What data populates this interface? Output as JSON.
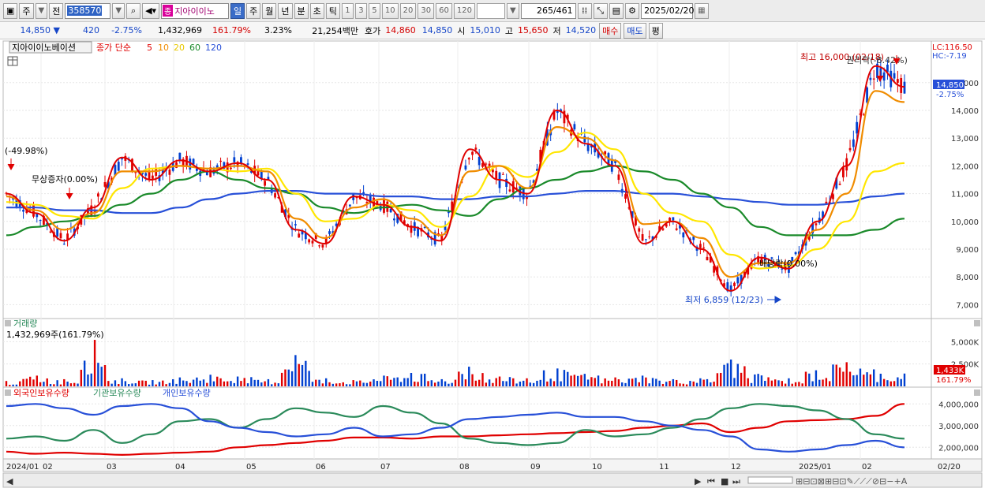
{
  "toolbar": {
    "period_label": "주",
    "prev_label": "전",
    "stock_code": "358570",
    "stock_tag": "종",
    "stock_name": "지아이이노",
    "tf_day": "일",
    "tf_week": "주",
    "tf_month": "월",
    "tf_year": "년",
    "tf_min": "분",
    "tf_sec": "초",
    "tf_tick": "틱",
    "intervals": [
      "1",
      "3",
      "5",
      "10",
      "20",
      "30",
      "60",
      "120"
    ],
    "count": "265",
    "count_total": "/461",
    "date": "2025/02/20"
  },
  "quote": {
    "price": "14,850",
    "change": "420",
    "change_pct": "-2.75%",
    "volume": "1,432,969",
    "volume_ratio": "161.79%",
    "turnover": "3.23%",
    "amount": "21,254백만",
    "bid_label": "호가",
    "bid1": "14,860",
    "bid2": "14,850",
    "open_label": "시",
    "open": "15,010",
    "high_label": "고",
    "high": "15,650",
    "low_label": "저",
    "low": "14,520",
    "buy_label": "매수",
    "sell_label": "매도",
    "eval_label": "평"
  },
  "legend": {
    "name": "지아이이노베이션",
    "ma_label": "종가 단순",
    "ma": [
      "5",
      "10",
      "20",
      "60",
      "120"
    ]
  },
  "colors": {
    "up": "#e00000",
    "down": "#0040d0",
    "ma5": "#e00000",
    "ma10": "#f08c00",
    "ma20": "#ffe600",
    "ma60": "#1a8a2a",
    "ma120": "#2850d8",
    "foreign": "#e00000",
    "institution": "#2a8a5a",
    "individual": "#2850d8"
  },
  "annotations": {
    "lc": "LC:116.50",
    "hc": "HC:-7.19",
    "max": "최고 16,000 (02/18)",
    "min": "최저 6,859 (12/23)",
    "right_issue": "권리락(-8.42%)",
    "drop1": "(-49.98%)",
    "bonus_issue": "무상증자(0.00%)",
    "dividend": "배당락(0.00%)",
    "price_tag": "14,850",
    "pct_tag": "-2.75%"
  },
  "volume_panel": {
    "title": "거래량",
    "value": "1,432,969주(161.79%)",
    "tag": "1,433K",
    "tag_pct": "161.79%"
  },
  "holding_panel": {
    "foreign": "외국인보유수량",
    "institution": "기관보유수량",
    "individual": "개인보유수량"
  },
  "chart_data": [
    {
      "type": "candlestick",
      "title": "지아이이노베이션",
      "x": [
        "2024/01",
        "02",
        "03",
        "04",
        "05",
        "06",
        "07",
        "08",
        "09",
        "10",
        "11",
        "12",
        "2025/01",
        "02",
        "02/20"
      ],
      "ylim": [
        6500,
        16500
      ],
      "yticks": [
        7000,
        8000,
        9000,
        10000,
        11000,
        12000,
        13000,
        14000,
        15000
      ],
      "ytick_labels": [
        "7,000",
        "8,000",
        "9,000",
        "10,000",
        "11,000",
        "12,000",
        "13,000",
        "14,000",
        "15,000"
      ],
      "series": [
        {
          "name": "5",
          "values": [
            11000,
            10300,
            9300,
            10500,
            12300,
            11500,
            12200,
            11800,
            12100,
            11500,
            9700,
            9200,
            10900,
            10600,
            9800,
            9300,
            12600,
            11500,
            11000,
            14000,
            12800,
            12000,
            9200,
            10000,
            9000,
            7500,
            8700,
            8300,
            10000,
            12000,
            15600,
            14850
          ]
        },
        {
          "name": "10",
          "values": [
            10900,
            10400,
            9700,
            10300,
            11800,
            11800,
            12000,
            11900,
            12000,
            11800,
            10100,
            9400,
            10500,
            10800,
            10100,
            9500,
            11800,
            12000,
            11200,
            13400,
            13000,
            12200,
            9900,
            10000,
            9400,
            8000,
            8500,
            8500,
            9700,
            11000,
            14700,
            14300
          ]
        },
        {
          "name": "20",
          "values": [
            10700,
            10600,
            10200,
            10100,
            11200,
            11900,
            12000,
            11900,
            11800,
            11900,
            11000,
            10000,
            10100,
            10600,
            10400,
            9800,
            10900,
            12000,
            11600,
            12500,
            13200,
            12600,
            11000,
            10300,
            10000,
            8800,
            8300,
            8400,
            9000,
            10000,
            11800,
            12100
          ]
        },
        {
          "name": "60",
          "values": [
            9500,
            9800,
            10000,
            10200,
            10600,
            11000,
            11500,
            11800,
            11500,
            11200,
            11000,
            10500,
            10300,
            10500,
            10600,
            10400,
            10200,
            10800,
            11200,
            11500,
            11800,
            12000,
            11800,
            11500,
            11000,
            10500,
            9800,
            9500,
            9500,
            9500,
            9700,
            10100
          ]
        },
        {
          "name": "120",
          "values": [
            10500,
            10500,
            10400,
            10400,
            10300,
            10300,
            10500,
            10800,
            11000,
            11100,
            11100,
            11000,
            11000,
            10900,
            10900,
            10800,
            10800,
            10900,
            10900,
            11000,
            11100,
            11100,
            11000,
            11000,
            10900,
            10800,
            10700,
            10600,
            10600,
            10700,
            10900,
            11000
          ]
        }
      ]
    },
    {
      "type": "bar",
      "title": "거래량",
      "ylim": [
        0,
        6000000
      ],
      "yticks": [
        2500000,
        5000000
      ],
      "ytick_labels": [
        "2,500K",
        "5,000K"
      ],
      "values": [
        600000,
        1200000,
        800000,
        5200000,
        900000,
        700000,
        1000000,
        1300000,
        1100000,
        800000,
        3500000,
        900000,
        700000,
        1200000,
        1500000,
        800000,
        2200000,
        1100000,
        900000,
        2000000,
        1400000,
        1000000,
        1200000,
        800000,
        900000,
        3000000,
        1400000,
        900000,
        1800000,
        2700000,
        1900000,
        1432969
      ]
    },
    {
      "type": "line",
      "title": "보유수량",
      "ylim": [
        1500000,
        4300000
      ],
      "yticks": [
        2000000,
        3000000,
        4000000
      ],
      "ytick_labels": [
        "2,000,000",
        "3,000,000",
        "4,000,000"
      ],
      "series": [
        {
          "name": "외국인보유수량",
          "values": [
            1800000,
            1700000,
            1750000,
            1700000,
            1650000,
            1700000,
            1750000,
            1800000,
            2000000,
            2100000,
            2200000,
            2300000,
            2450000,
            2450000,
            2400000,
            2500000,
            2500000,
            2550000,
            2600000,
            2650000,
            2700000,
            2750000,
            2900000,
            3000000,
            3100000,
            2700000,
            2900000,
            3200000,
            3250000,
            3300000,
            3450000,
            4000000
          ]
        },
        {
          "name": "기관보유수량",
          "values": [
            2400000,
            2500000,
            2300000,
            2800000,
            2200000,
            2600000,
            3200000,
            3300000,
            2900000,
            3300000,
            3800000,
            3600000,
            3400000,
            3900000,
            3600000,
            3100000,
            2400000,
            2200000,
            2100000,
            2200000,
            2800000,
            2500000,
            2600000,
            2900000,
            3300000,
            3800000,
            4000000,
            3900000,
            3700000,
            3300000,
            2600000,
            2400000
          ]
        },
        {
          "name": "개인보유수량",
          "values": [
            3900000,
            4000000,
            3800000,
            3500000,
            3900000,
            4000000,
            3800000,
            3200000,
            2900000,
            2700000,
            2500000,
            2600000,
            2900000,
            2500000,
            2600000,
            2900000,
            3300000,
            3400000,
            3500000,
            3600000,
            3400000,
            3400000,
            3200000,
            3000000,
            2800000,
            2500000,
            1900000,
            1800000,
            1900000,
            2100000,
            2300000,
            2000000
          ]
        }
      ]
    }
  ]
}
